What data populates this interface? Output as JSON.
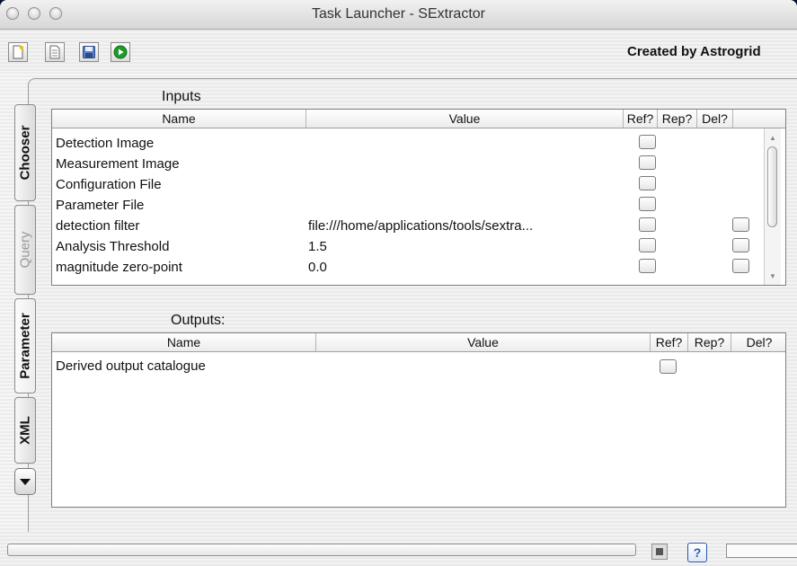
{
  "window": {
    "title": "Task Launcher - SExtractor"
  },
  "toolbar": {
    "buttons": [
      "new-icon",
      "document-icon",
      "save-icon",
      "run-icon"
    ],
    "created_by": "Created by Astrogrid"
  },
  "side_tabs": [
    {
      "label": "Chooser",
      "state": "normal"
    },
    {
      "label": "Query",
      "state": "disabled"
    },
    {
      "label": "Parameter",
      "state": "selected"
    },
    {
      "label": "XML",
      "state": "normal"
    }
  ],
  "inputs": {
    "label": "Inputs",
    "columns": [
      "Name",
      "Value",
      "Ref?",
      "Rep?",
      "Del?"
    ],
    "rows": [
      {
        "name": "Detection Image",
        "value": "",
        "ref": true,
        "del": false
      },
      {
        "name": "Measurement Image",
        "value": "",
        "ref": true,
        "del": false
      },
      {
        "name": "Configuration File",
        "value": "",
        "ref": true,
        "del": false
      },
      {
        "name": "Parameter File",
        "value": "",
        "ref": true,
        "del": false
      },
      {
        "name": "detection filter",
        "value": "file:///home/applications/tools/sextra...",
        "ref": true,
        "del": true
      },
      {
        "name": "Analysis Threshold",
        "value": "1.5",
        "ref": true,
        "del": true
      },
      {
        "name": "magnitude zero-point",
        "value": "0.0",
        "ref": true,
        "del": true
      }
    ]
  },
  "outputs": {
    "label": "Outputs:",
    "columns": [
      "Name",
      "Value",
      "Ref?",
      "Rep?",
      "Del?"
    ],
    "rows": [
      {
        "name": "Derived output catalogue",
        "value": "",
        "ref": true
      }
    ]
  },
  "status": {
    "help_label": "?"
  },
  "colors": {
    "accent": "#2e56a8",
    "run": "#1f9a2b"
  }
}
